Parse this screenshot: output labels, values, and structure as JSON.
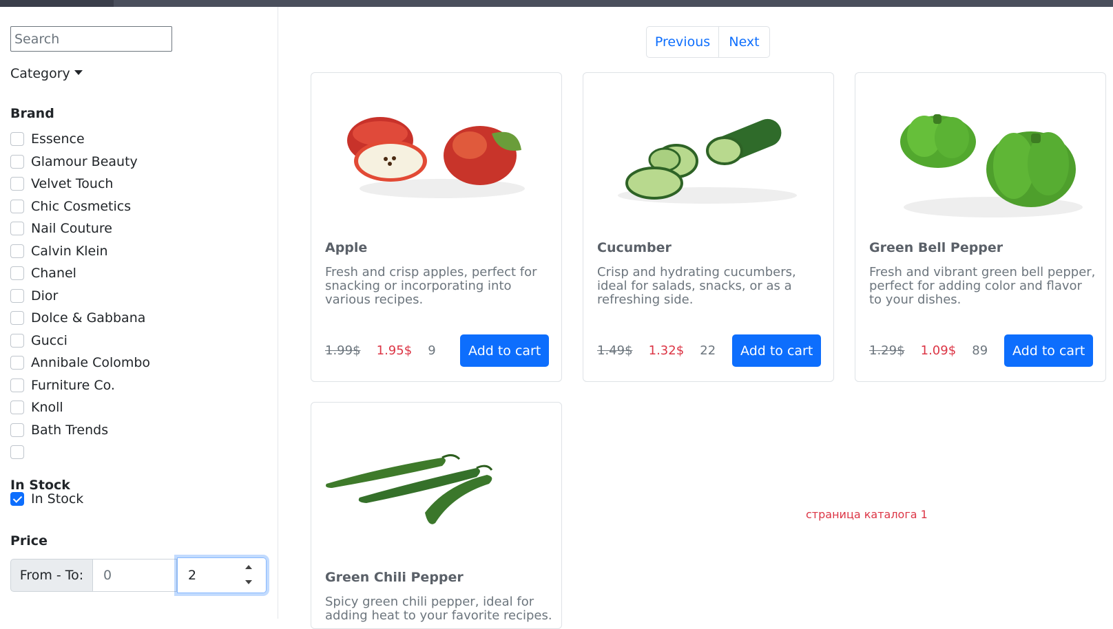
{
  "search": {
    "placeholder": "Search"
  },
  "filters": {
    "category_label": "Category",
    "brand_title": "Brand",
    "brands": [
      "Essence",
      "Glamour Beauty",
      "Velvet Touch",
      "Chic Cosmetics",
      "Nail Couture",
      "Calvin Klein",
      "Chanel",
      "Dior",
      "Dolce & Gabbana",
      "Gucci",
      "Annibale Colombo",
      "Furniture Co.",
      "Knoll",
      "Bath Trends",
      ""
    ],
    "in_stock_title": "In Stock",
    "in_stock_label": "In Stock",
    "in_stock_checked": true,
    "price_title": "Price",
    "price_label": "From - To:",
    "price_from_value": "0",
    "price_to_value": "2"
  },
  "pagination": {
    "previous": "Previous",
    "next": "Next"
  },
  "products": [
    {
      "title": "Apple",
      "description": "Fresh and crisp apples, perfect for snacking or incorporating into various recipes.",
      "old_price": "1.99$",
      "price": "1.95$",
      "stock": "9",
      "button": "Add to cart",
      "image_icon": "apple-image"
    },
    {
      "title": "Cucumber",
      "description": "Crisp and hydrating cucumbers, ideal for salads, snacks, or as a refreshing side.",
      "old_price": "1.49$",
      "price": "1.32$",
      "stock": "22",
      "button": "Add to cart",
      "image_icon": "cucumber-image"
    },
    {
      "title": "Green Bell Pepper",
      "description": "Fresh and vibrant green bell pepper, perfect for adding color and flavor to your dishes.",
      "old_price": "1.29$",
      "price": "1.09$",
      "stock": "89",
      "button": "Add to cart",
      "image_icon": "bell-pepper-image"
    },
    {
      "title": "Green Chili Pepper",
      "description": "Spicy green chili pepper, ideal for adding heat to your favorite recipes.",
      "old_price": "",
      "price": "",
      "stock": "",
      "button": "",
      "image_icon": "chili-pepper-image"
    }
  ],
  "page_note": "страница каталога 1",
  "colors": {
    "primary": "#0d6efd",
    "price_red": "#dc3545",
    "muted": "#6c757d"
  }
}
